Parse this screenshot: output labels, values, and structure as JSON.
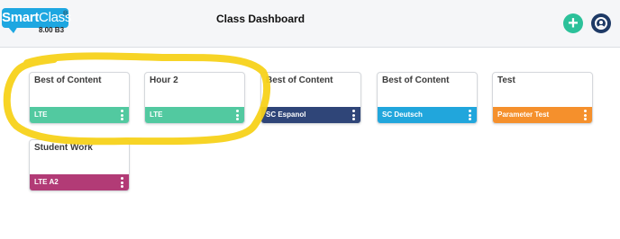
{
  "header": {
    "logo": {
      "text_bold": "Smart",
      "text_light": "Class",
      "registered": "®",
      "version": "8.00 B3",
      "color": "#1ea7e1"
    },
    "title": "Class Dashboard",
    "add_icon": "plus-circle-icon",
    "user_icon": "user-circle-icon"
  },
  "classes": [
    {
      "name": "Best of Content",
      "label": "LTE",
      "color": "#52c9a0"
    },
    {
      "name": "Hour 2",
      "label": "LTE",
      "color": "#52c9a0"
    },
    {
      "name": "Best of Content",
      "label": "SC Espanol",
      "color": "#2f4578"
    },
    {
      "name": "Best of Content",
      "label": "SC Deutsch",
      "color": "#21a6dc"
    },
    {
      "name": "Test",
      "label": "Parameter Test",
      "color": "#f5902c"
    },
    {
      "name": "Student Work",
      "label": "LTE A2",
      "color": "#b23b76"
    }
  ],
  "annotation": {
    "color": "#f7d21a"
  }
}
